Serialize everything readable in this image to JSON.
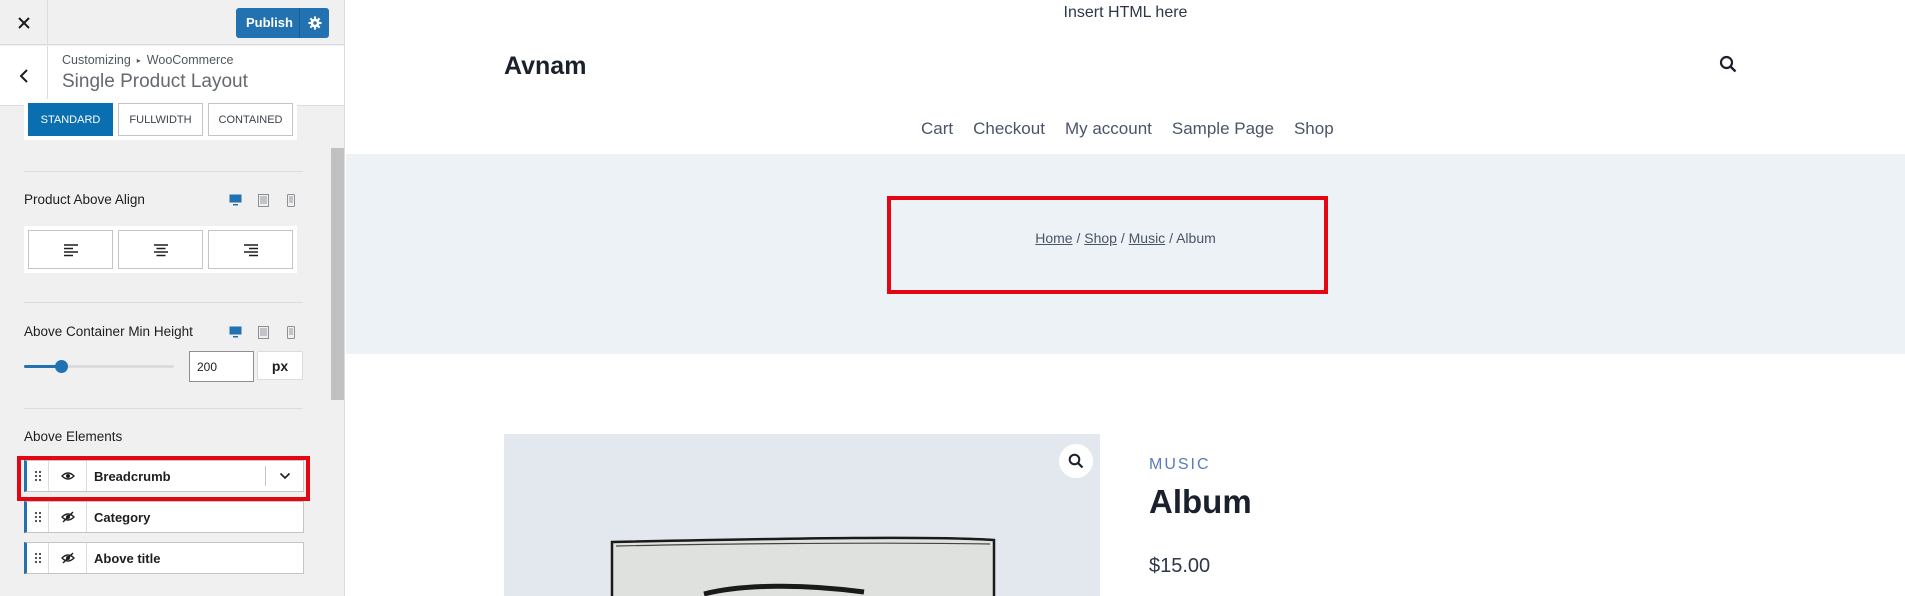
{
  "topbar": {
    "close_icon": "close-icon",
    "publish_label": "Publish",
    "settings_icon": "gear-icon"
  },
  "section": {
    "breadcrumb_root": "Customizing",
    "breadcrumb_parent": "WooCommerce",
    "title": "Single Product Layout"
  },
  "layout_options": {
    "items": [
      "STANDARD",
      "FULLWIDTH",
      "CONTAINED"
    ],
    "selected": "STANDARD"
  },
  "product_above_align": {
    "label": "Product Above Align",
    "options": [
      "align-left",
      "align-center",
      "align-right"
    ],
    "device_icons": [
      "desktop-icon",
      "tablet-icon",
      "mobile-icon"
    ]
  },
  "above_min_height": {
    "label": "Above Container Min Height",
    "value": "200",
    "unit": "px",
    "slider_fraction": 0.25
  },
  "above_elements": {
    "label": "Above Elements",
    "items": [
      {
        "name": "Breadcrumb",
        "visible": true
      },
      {
        "name": "Category",
        "visible": false
      },
      {
        "name": "Above title",
        "visible": false
      }
    ]
  },
  "preview": {
    "insert_html": "Insert HTML here",
    "site_title": "Avnam",
    "nav": [
      "Cart",
      "Checkout",
      "My account",
      "Sample Page",
      "Shop"
    ],
    "breadcrumb": {
      "home": "Home",
      "sep": "/",
      "shop": "Shop",
      "music": "Music",
      "current": "Album"
    },
    "product": {
      "category": "MUSIC",
      "title": "Album",
      "price": "$15.00"
    }
  },
  "colors": {
    "accent": "#2271b1",
    "highlight": "#e40613",
    "hero_bg": "#edf2f7"
  }
}
